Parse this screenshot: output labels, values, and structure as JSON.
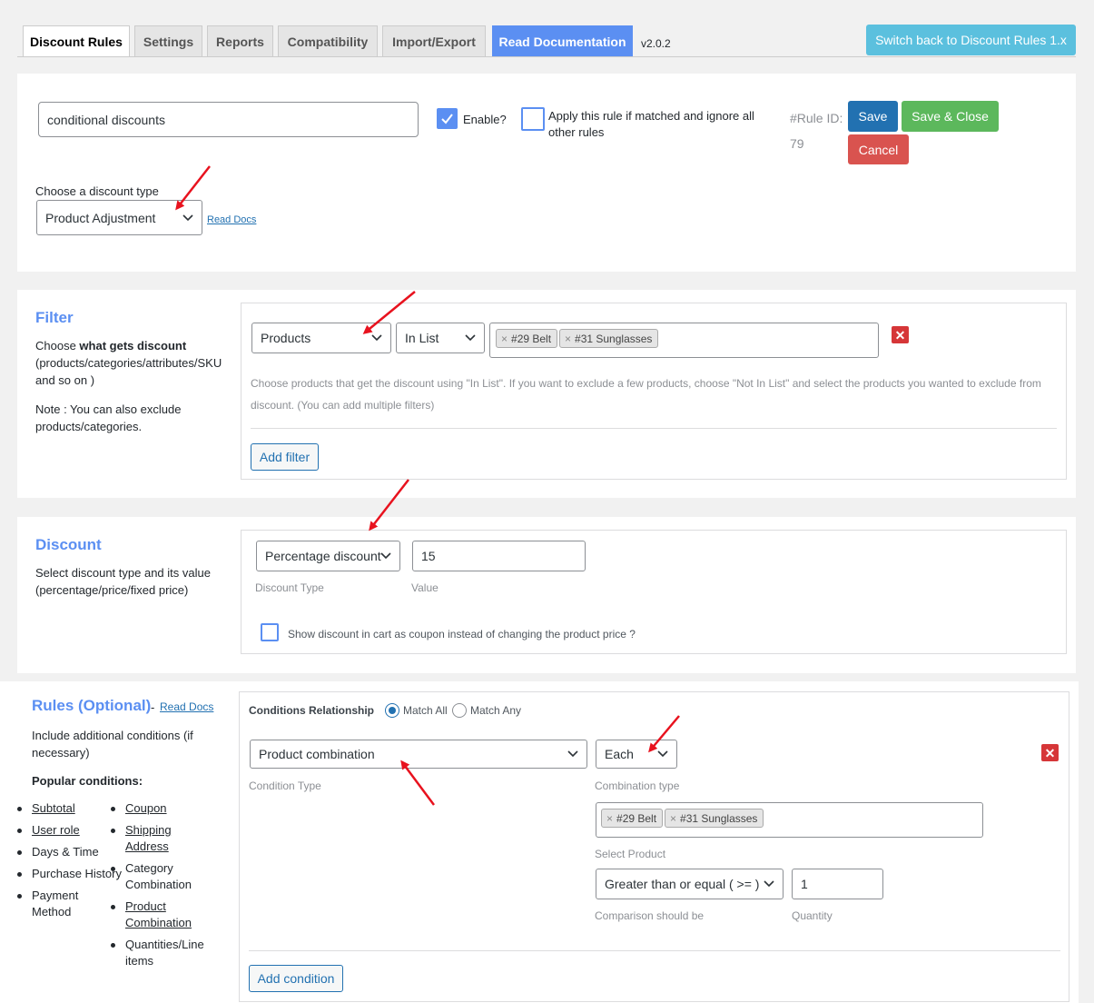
{
  "tabs": [
    {
      "label": "Discount Rules"
    },
    {
      "label": "Settings"
    },
    {
      "label": "Reports"
    },
    {
      "label": "Compatibility"
    },
    {
      "label": "Import/Export"
    },
    {
      "label": "Read Documentation"
    }
  ],
  "version": "v2.0.2",
  "switch_button": "Switch back to Discount Rules 1.x",
  "rule": {
    "name": "conditional discounts",
    "enable_label": "Enable?",
    "enabled": true,
    "apply_label": "Apply this rule if matched and ignore all other rules",
    "apply_checked": false,
    "rule_id_label": "#Rule ID:",
    "rule_id": "79",
    "save": "Save",
    "save_close": "Save & Close",
    "cancel": "Cancel",
    "discount_type_label": "Choose a discount type",
    "discount_type": "Product Adjustment",
    "read_docs": "Read Docs"
  },
  "filter": {
    "title": "Filter",
    "desc_prefix": "Choose ",
    "desc_bold": "what gets discount",
    "desc_rest": "(products/categories/attributes/SKU and so on )",
    "note": "Note : You can also exclude products/categories.",
    "type": "Products",
    "method": "In List",
    "tags": [
      "#29 Belt",
      "#31 Sunglasses"
    ],
    "help": "Choose products that get the discount using \"In List\". If you want to exclude a few products, choose \"Not In List\" and select the products you wanted to exclude from discount. (You can add multiple filters)",
    "add_button": "Add filter"
  },
  "discount": {
    "title": "Discount",
    "desc": "Select discount type and its value (percentage/price/fixed price)",
    "type": "Percentage discount",
    "value": "15",
    "type_label": "Discount Type",
    "value_label": "Value",
    "coupon_label": "Show discount in cart as coupon instead of changing the product price ?",
    "coupon_checked": false
  },
  "rules": {
    "title": "Rules (Optional)",
    "dash": "-",
    "read_docs": "Read Docs",
    "desc": "Include additional conditions (if necessary)",
    "popular_label": "Popular conditions:",
    "popular_left": [
      {
        "label": "Subtotal",
        "link": true
      },
      {
        "label": "User role",
        "link": true
      },
      {
        "label": "Days & Time",
        "link": false
      },
      {
        "label": "Purchase History",
        "link": false
      },
      {
        "label": "Payment Method",
        "link": false
      }
    ],
    "popular_right": [
      {
        "label": "Coupon",
        "link": true
      },
      {
        "label": "Shipping Address",
        "link": true
      },
      {
        "label": "Category Combination",
        "link": false
      },
      {
        "label": "Product Combination",
        "link": true
      },
      {
        "label": "Quantities/Line items",
        "link": false
      }
    ],
    "relationship_label": "Conditions Relationship",
    "match_all": "Match All",
    "match_any": "Match Any",
    "relationship": "Match All",
    "condition_type": "Product combination",
    "condition_type_label": "Condition Type",
    "combination": "Each",
    "combination_label": "Combination type",
    "tags": [
      "#29 Belt",
      "#31 Sunglasses"
    ],
    "select_product_label": "Select Product",
    "comparison": "Greater than or equal ( >= )",
    "comparison_label": "Comparison should be",
    "quantity": "1",
    "quantity_label": "Quantity",
    "add_button": "Add condition"
  },
  "colors": {
    "accent": "#5b8ff2",
    "save": "#2271b1",
    "save_close": "#5cb85c",
    "cancel": "#d9534f",
    "switch": "#5bc0de",
    "danger": "#d63638",
    "annotation_arrow": "#e8121e"
  }
}
